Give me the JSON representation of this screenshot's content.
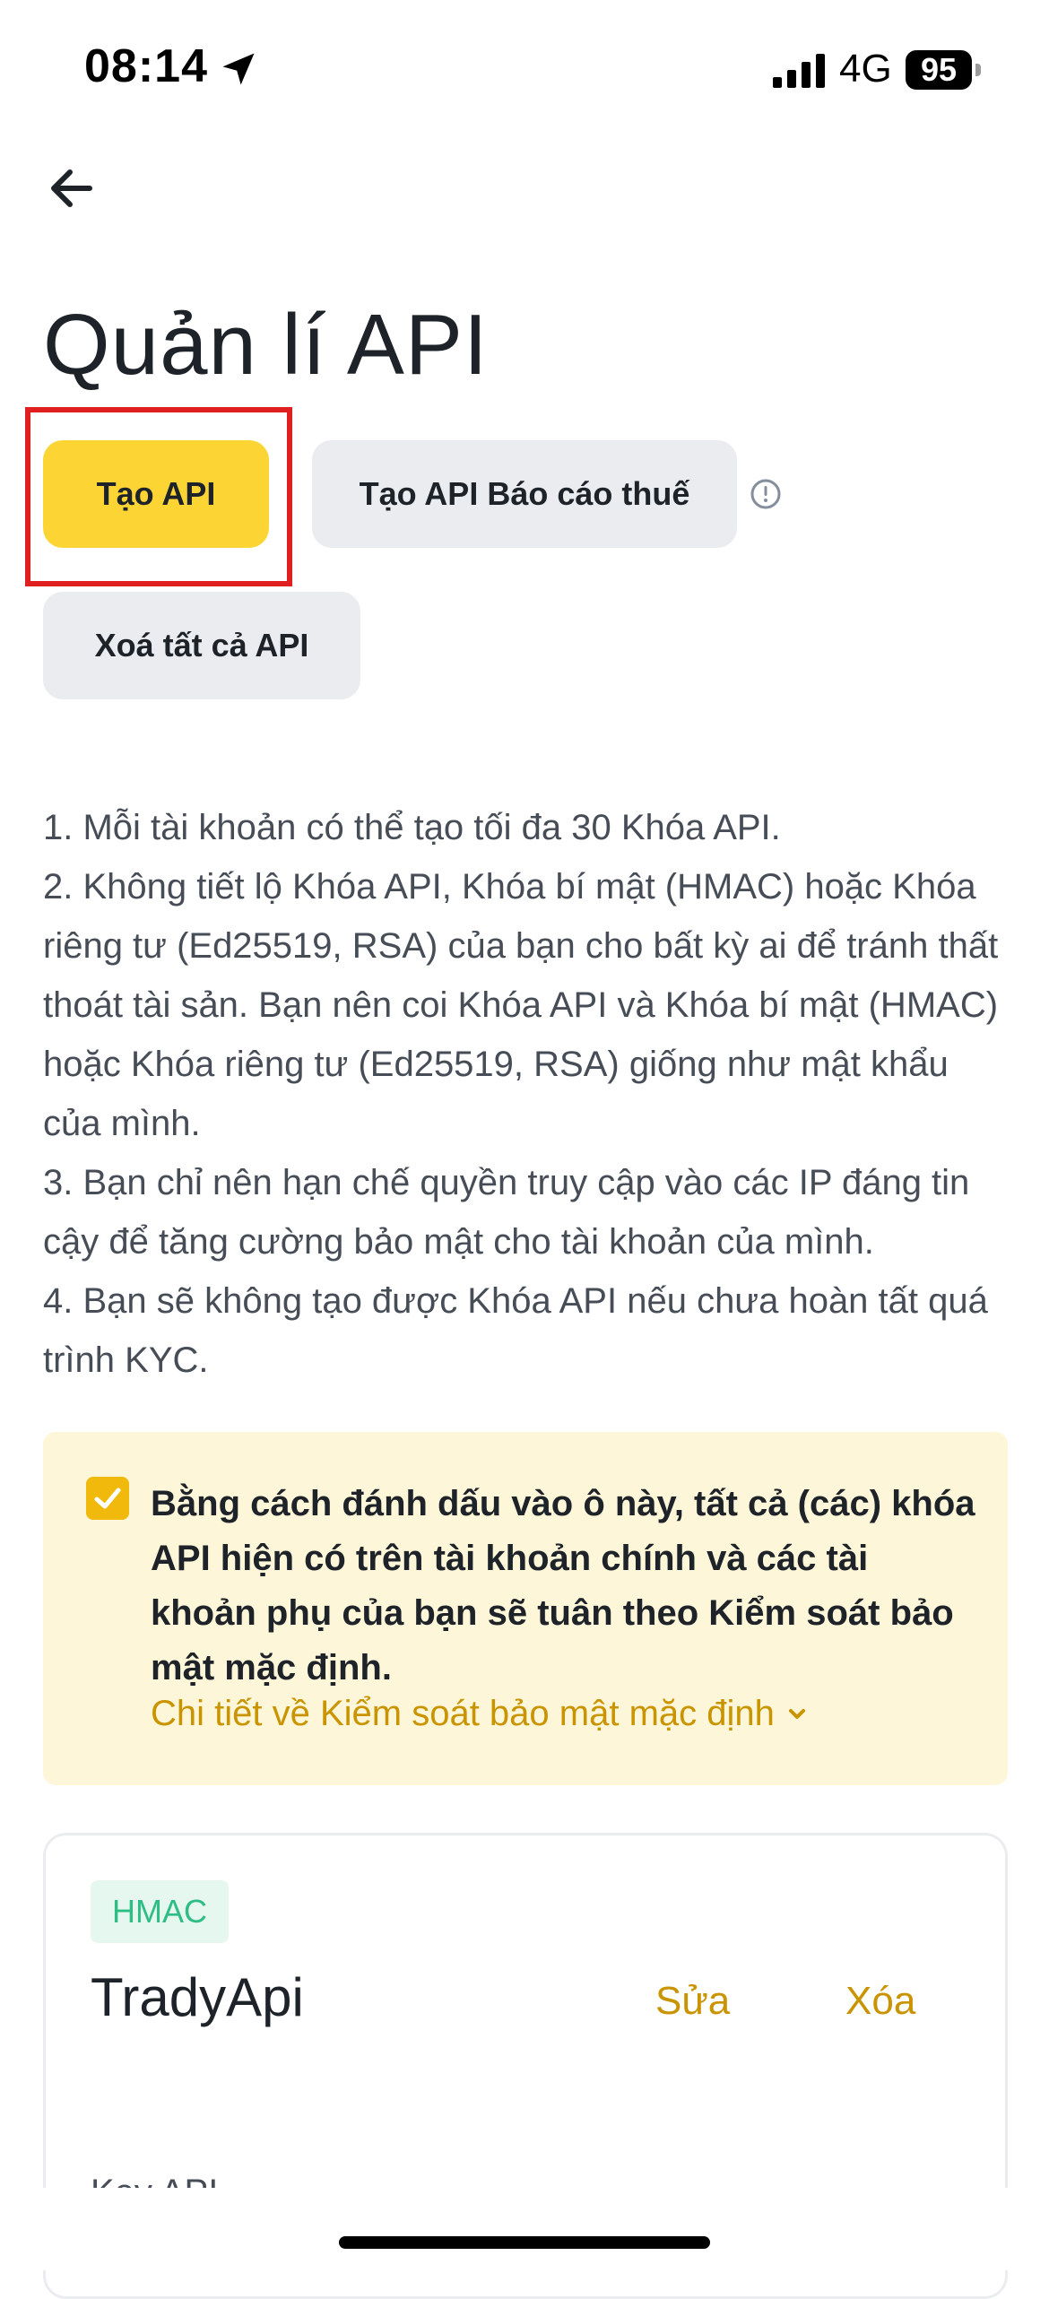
{
  "status_bar": {
    "time": "08:14",
    "network": "4G",
    "battery": "95"
  },
  "page": {
    "title": "Quản lí API"
  },
  "actions": {
    "create_api": "Tạo API",
    "create_tax_api": "Tạo API Báo cáo thuế",
    "delete_all_api": "Xoá tất cả API"
  },
  "notes": [
    "1. Mỗi tài khoản có thể tạo tối đa 30 Khóa API.",
    "2. Không tiết lộ Khóa API, Khóa bí mật (HMAC) hoặc Khóa riêng tư (Ed25519, RSA) của bạn cho bất kỳ ai để tránh thất thoát tài sản. Bạn nên coi Khóa API và Khóa bí mật (HMAC) hoặc Khóa riêng tư (Ed25519, RSA) giống như mật khẩu của mình.",
    "3. Bạn chỉ nên hạn chế quyền truy cập vào các IP đáng tin cậy để tăng cường bảo mật cho tài khoản của mình.",
    "4. Bạn sẽ không tạo được Khóa API nếu chưa hoàn tất quá trình KYC."
  ],
  "security_panel": {
    "checked": true,
    "text": "Bằng cách đánh dấu vào ô này, tất cả (các) khóa API hiện có trên tài khoản chính và các tài khoản phụ của bạn sẽ tuân theo Kiểm soát bảo mật mặc định.",
    "link": "Chi tiết về Kiểm soát bảo mật mặc định"
  },
  "api_card": {
    "badge": "HMAC",
    "name": "TradyApi",
    "edit": "Sửa",
    "delete": "Xóa",
    "key_label": "Key API"
  },
  "colors": {
    "accent": "#fcd535",
    "link": "#c99400",
    "highlight": "#e02020",
    "badge_text": "#2ebd85"
  }
}
